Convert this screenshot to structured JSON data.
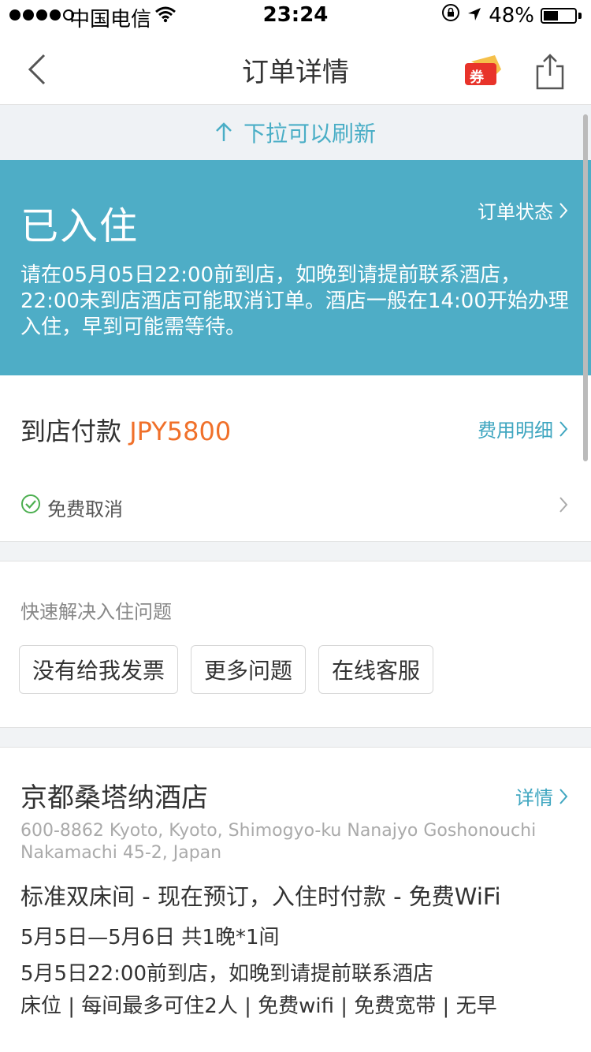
{
  "status_bar": {
    "carrier": "中国电信",
    "time": "23:24",
    "battery": "48%",
    "battery_level": 0.48
  },
  "nav": {
    "title": "订单详情",
    "coupon_label": "券"
  },
  "pull_refresh": {
    "label": "下拉可以刷新"
  },
  "order_status": {
    "title": "已入住",
    "link": "订单状态",
    "note": "请在05月05日22:00前到店，如晚到请提前联系酒店，22:00未到店酒店可能取消订单。酒店一般在14:00开始办理入住，早到可能需等待。"
  },
  "payment": {
    "label": "到店付款",
    "amount": "JPY5800",
    "fee_link": "费用明细"
  },
  "cancellation": {
    "text": "免费取消"
  },
  "quick_help": {
    "heading": "快速解决入住问题",
    "buttons": [
      "没有给我发票",
      "更多问题",
      "在线客服"
    ]
  },
  "hotel": {
    "name": "京都桑塔纳酒店",
    "detail_link": "详情",
    "address": "600-8862 Kyoto, Kyoto, Shimogyo-ku Nanajyo Goshonouchi Nakamachi 45-2, Japan",
    "room": "标准双床间 - 现在预订，入住时付款 - 免费WiFi",
    "dates": "5月5日—5月6日 共1晚*1间",
    "arrival": "5月5日22:00前到店，如晚到请提前联系酒店",
    "amenities": "床位 | 每间最多可住2人 | 免费wifi | 免费宽带 | 无早"
  },
  "colors": {
    "accent": "#4eadc6",
    "price": "#f0702a",
    "link": "#3fa6c0"
  }
}
